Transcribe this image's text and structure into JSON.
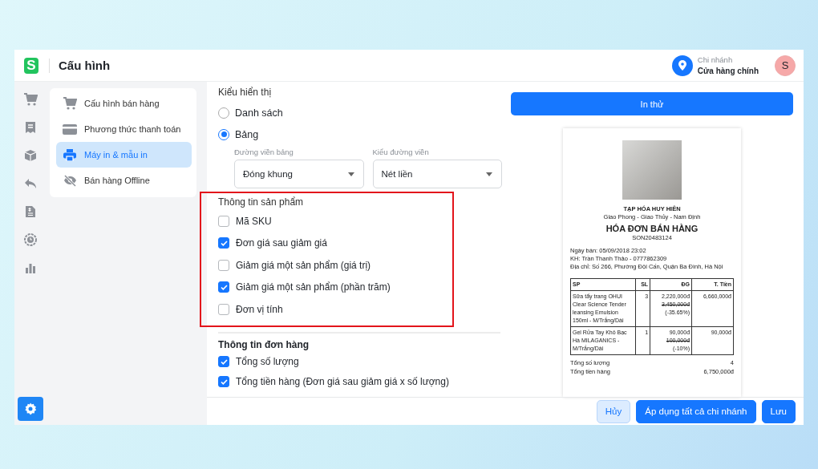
{
  "header": {
    "logo_letter": "S",
    "title": "Cấu hình",
    "branch_label": "Chi nhánh",
    "branch_name": "Cửa hàng chính",
    "avatar_letter": "S"
  },
  "rail_top": [
    {
      "kind": "cart",
      "selected": false
    },
    {
      "kind": "receipt",
      "selected": false
    },
    {
      "kind": "box",
      "selected": false
    },
    {
      "kind": "reply",
      "selected": false
    },
    {
      "kind": "invoice",
      "selected": false
    },
    {
      "kind": "gauge",
      "selected": false
    },
    {
      "kind": "chart",
      "selected": false
    }
  ],
  "rail_bottom": [
    {
      "kind": "gear",
      "selected": true
    }
  ],
  "submenu": [
    {
      "kind": "cart",
      "label": "Cấu hình bán hàng",
      "selected": false
    },
    {
      "kind": "card",
      "label": "Phương thức thanh toán",
      "selected": false
    },
    {
      "kind": "printer",
      "label": "Máy in & mẫu in",
      "selected": true
    },
    {
      "kind": "offline",
      "label": "Bán hàng Offline",
      "selected": false
    }
  ],
  "display": {
    "title": "Kiểu hiển thị",
    "options": [
      {
        "label": "Danh sách",
        "selected": false
      },
      {
        "label": "Bảng",
        "selected": true
      }
    ],
    "selects": [
      {
        "label": "Đường viền bảng",
        "value": "Đóng khung"
      },
      {
        "label": "Kiểu đường viền",
        "value": "Nét liền"
      }
    ]
  },
  "product_info": {
    "title": "Thông tin sản phẩm",
    "highlighted": true,
    "items": [
      {
        "label": "Mã SKU",
        "checked": false
      },
      {
        "label": "Đơn giá sau giảm giá",
        "checked": true
      },
      {
        "label": "Giảm giá một sản phẩm (giá trị)",
        "checked": false
      },
      {
        "label": "Giảm giá một sản phẩm (phần trăm)",
        "checked": true
      },
      {
        "label": "Đơn vị tính",
        "checked": false
      }
    ]
  },
  "order_info": {
    "title": "Thông tin đơn hàng",
    "items": [
      {
        "label": "Tổng số lượng",
        "checked": true
      },
      {
        "label": "Tổng tiền hàng (Đơn giá sau giảm giá x số lượng)",
        "checked": true
      }
    ]
  },
  "test_print_button": "In thử",
  "receipt": {
    "store": "TẠP HÓA HUY HIÊN",
    "address": "Giao Phong - Giao Thủy - Nam Định",
    "title": "HÓA ĐƠN BÁN HÀNG",
    "code": "SON20483124",
    "info": [
      "Ngày bán: 05/09/2018 23:02",
      "KH: Trần Thanh Thảo - 0777862309",
      "Địa chỉ: Số 266, Phường Đội Cấn, Quận Ba Đình, Hà Nội"
    ],
    "columns": [
      "SP",
      "SL",
      "ĐG",
      "T. Tiền"
    ],
    "rows": [
      {
        "product": "Sữa tẩy trang OHUI Clear Science Tender leansing Emulsion 150ml - M/Trắng/Dài",
        "qty": "3",
        "price": "2,220,000đ",
        "old_price": "3,450,000đ",
        "discount": "(-35.65%)",
        "total": "6,660,000đ"
      },
      {
        "product": "Gel Rửa Tay Khô Bạc Hà MILAGANICS - M/Trắng/Dài",
        "qty": "1",
        "price": "90,000đ",
        "old_price": "100,000đ",
        "discount": "(-10%)",
        "total": "90,000đ"
      }
    ],
    "summary": [
      {
        "label": "Tổng số lượng",
        "value": "4"
      },
      {
        "label": "Tổng tiền hàng",
        "value": "6,750,000đ"
      }
    ]
  },
  "footer_buttons": [
    {
      "label": "Hủy",
      "kind": "secondary"
    },
    {
      "label": "Áp dụng tất cả chi nhánh",
      "kind": "primary"
    },
    {
      "label": "Lưu",
      "kind": "primary"
    }
  ]
}
